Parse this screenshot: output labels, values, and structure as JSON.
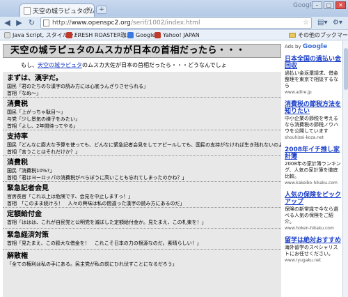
{
  "browser": {
    "tab_title": "天空の城ラピュタのムスカが…",
    "brand": "Google",
    "url_host": "www.openspc2.org",
    "url_path": "/serif/1002/index.html",
    "bookmarks": [
      "Java Script, スタイルシ…",
      "FRESH ROASTER珈…",
      "Google",
      "Yahoo! JAPAN"
    ],
    "other_bookmarks": "その他のブックマーク"
  },
  "page": {
    "title": "天空の城ラピュタのムスカが日本の首相だったら・・・",
    "intro_prefix": "もし、",
    "intro_link": "天空の城ラピュタ",
    "intro_suffix": "のムスカ大佐が日本の首相だったら・・・どうなんでしょ",
    "entries": [
      {
        "title": "まずは、漢字だ。",
        "lines": [
          "国民「君のたちのな漢字の読み方には心底うんざりさせられる」",
          "首相「なぬ～」"
        ]
      },
      {
        "title": "消費税",
        "lines": [
          "国民「上がっちゃ駄目～」",
          "与党「少し景気の様子をみたい」",
          "首相「よし、2年間待ってやる」"
        ]
      },
      {
        "title": "支持率",
        "lines": [
          "国民「どんなに膨大な予算を使っても、どんなに緊急記者会見をしてアピールしても、国民の支持がなければ生き残れないのよ！」",
          "首相「言うことはそれだけか？」"
        ]
      },
      {
        "title": "消費税",
        "lines": [
          "国民「消費税10%?」",
          "首相「君はヨーロッパの消費税がべらぼうに高いことも忘れてしまったのかね？」"
        ]
      },
      {
        "title": "緊急記者会見",
        "lines": [
          "官房長官「これ以上は危険です、会見を中止しますっ！」",
          "首相　「このまま続けろ！　人々の興味は私の間違った漢字の読み方にあるのだ」"
        ]
      },
      {
        "title": "定額給付金",
        "lines": [
          "首相「ははは、これが自民党と公明党を滅ぼした定額給付金か。見たまえ、この札束を！」"
        ]
      },
      {
        "title": "緊急経済対策",
        "lines": [
          "首相「見たまえ、この膨大な借金を！　これこそ日本の力の根源なのだ。素晴らしい！」"
        ]
      },
      {
        "title": "解散権",
        "lines": [
          "「全ての権利は私の手にある。民主党が私の前にひれ伏すことになるだろう」"
        ]
      }
    ]
  },
  "ads": {
    "label_prefix": "Ads by",
    "label_brand": "Google",
    "items": [
      {
        "title": "日本全国の過払い金回収",
        "text": "過払い金返還請求、借金整理を東京で相談するなら",
        "url": "www.adire.jp"
      },
      {
        "title": "消費税の節税方法を知りたい",
        "text": "中小企業の節税を考えるなら消費税の節税ノウハウを公開しています",
        "url": "shouhizei-koza.net"
      },
      {
        "title": "2008年イチ推し家計簿",
        "text": "2008年の家計簿ランキング、人気の家計簿を徹底比較。",
        "url": "www.kakeibo-hikaku.com"
      },
      {
        "title": "人気の保険をピックアップ",
        "text": "保険の新常識で今なら選べる人気の保険をご紹介。",
        "url": "www.hoken-hikaku.com"
      },
      {
        "title": "留学は絶対おすすめ",
        "text": "海外留学のスペシャリストにお任せください。",
        "url": "www.ryugaku.net"
      }
    ]
  },
  "colors": {
    "headline_bg": "#d3d3d3",
    "entries_bg": "#e8e8e8",
    "link": "#1a3fc8"
  }
}
